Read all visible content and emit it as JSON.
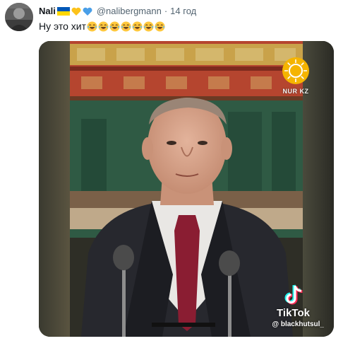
{
  "tweet": {
    "display_name": "Nali",
    "name_emoji": [
      "ukraine-flag-icon",
      "yellow-heart-icon",
      "blue-heart-icon"
    ],
    "handle": "@nalibergmann",
    "separator": "·",
    "time": "14 год",
    "text": "Ну это хит",
    "text_emoji": [
      "tears-of-joy-emoji",
      "tears-of-joy-emoji",
      "tears-of-joy-emoji",
      "tears-of-joy-emoji",
      "tears-of-joy-emoji",
      "tears-of-joy-emoji",
      "tears-of-joy-emoji"
    ]
  },
  "media": {
    "source_logo_text": "NUR KZ",
    "tiktok_wordmark": "TikTok",
    "tiktok_username": "@ blackhutsul_"
  },
  "colors": {
    "text_primary": "#0f1419",
    "text_secondary": "#536471",
    "tiktok_cyan": "#25f4ee",
    "tiktok_red": "#fe2c55",
    "nur_yellow": "#f5b400"
  }
}
